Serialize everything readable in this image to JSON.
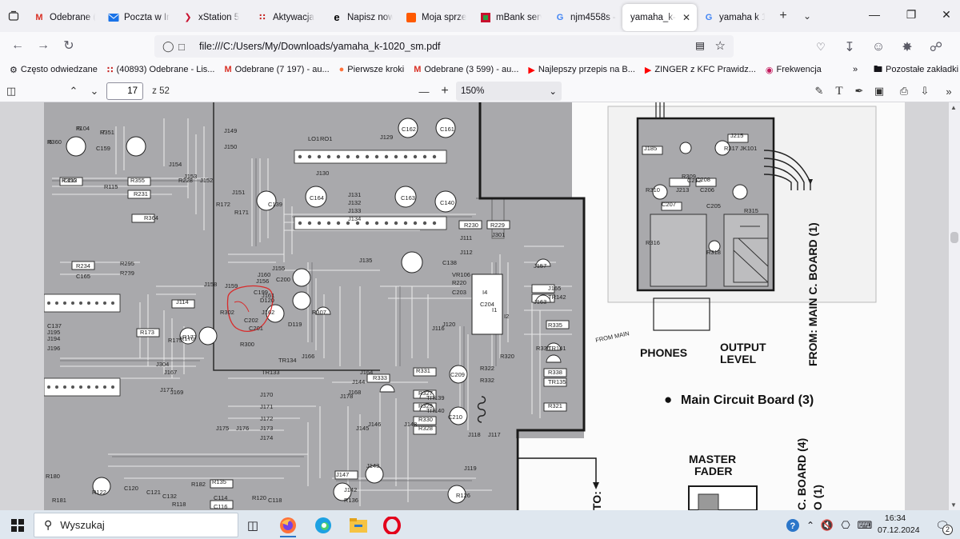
{
  "tabs": [
    {
      "title": "Odebrane (",
      "icon": "gmail-icon"
    },
    {
      "title": "Poczta w In",
      "icon": "mail-icon"
    },
    {
      "title": "xStation 5",
      "icon": "xstation-icon"
    },
    {
      "title": "Aktywacja",
      "icon": "grid-icon"
    },
    {
      "title": "Napisz now",
      "icon": "edge-e-icon"
    },
    {
      "title": "Moja sprze",
      "icon": "allegro-icon"
    },
    {
      "title": "mBank serv",
      "icon": "mbank-icon"
    },
    {
      "title": "njm4558s -",
      "icon": "google-icon"
    },
    {
      "title": "yamaha_k-1(",
      "icon": "none",
      "active": true
    },
    {
      "title": "yamaha k 1",
      "icon": "google-icon"
    }
  ],
  "url": "file:///C:/Users/My/Downloads/yamaha_k-1020_sm.pdf",
  "bookmarks": [
    {
      "label": "Często odwiedzane",
      "icon": "gear-icon"
    },
    {
      "label": "(40893) Odebrane - Lis...",
      "icon": "grid-icon"
    },
    {
      "label": "Odebrane (7 197) - au...",
      "icon": "gmail-icon"
    },
    {
      "label": "Pierwsze kroki",
      "icon": "firefox-icon"
    },
    {
      "label": "Odebrane (3 599) - au...",
      "icon": "gmail-icon"
    },
    {
      "label": "Najlepszy przepis na B...",
      "icon": "youtube-icon"
    },
    {
      "label": "ZINGER z KFC Prawidz...",
      "icon": "youtube-icon"
    },
    {
      "label": "Frekwencja",
      "icon": "link-icon"
    }
  ],
  "bookmarks_other": "Pozostałe zakładki",
  "pdf": {
    "page_current": "17",
    "page_total": "z 52",
    "zoom": "150%"
  },
  "schematic": {
    "labels_main": [
      "PHONES",
      "OUTPUT",
      "LEVEL",
      "Main Circuit Board (3)",
      "MASTER",
      "FADER",
      "FROM: MAIN C. BOARD (1)",
      "C. BOARD (4)",
      "O (1)",
      "TO:",
      "FROM MAIN"
    ],
    "parts": [
      "R360",
      "F104",
      "R351",
      "R356",
      "C159",
      "R115",
      "R355",
      "R231",
      "R228",
      "J154",
      "J149",
      "J150",
      "R364",
      "J153",
      "J152",
      "R172",
      "J151",
      "R171",
      "J155",
      "J160",
      "J161",
      "J162",
      "C139",
      "J129",
      "LO1",
      "RO1",
      "C162",
      "C161",
      "C164",
      "C163",
      "C140",
      "J130",
      "J131",
      "J132",
      "J133",
      "J134",
      "J135",
      "R230",
      "R229",
      "J111",
      "J301",
      "J112",
      "C138",
      "R234",
      "C165",
      "R295",
      "R239",
      "J158",
      "J159",
      "J156",
      "D120",
      "C200",
      "C199",
      "C202",
      "C201",
      "D119",
      "R302",
      "R307",
      "R300",
      "TR133",
      "TR134",
      "J166",
      "J157",
      "J165",
      "J163",
      "TR142",
      "R335",
      "R336",
      "TR141",
      "R338",
      "TR135",
      "R321",
      "R320",
      "R322",
      "R332",
      "R333",
      "R331",
      "R327",
      "R329",
      "R330",
      "R328",
      "C209",
      "C210",
      "TR139",
      "TR140",
      "J164",
      "J148",
      "J118",
      "J119",
      "J117",
      "J120",
      "J116",
      "J114",
      "R173",
      "R175",
      "R176",
      "R177",
      "C137",
      "J195",
      "J194",
      "J196",
      "J304",
      "J167",
      "J169",
      "J170",
      "J171",
      "J172",
      "J173",
      "J174",
      "J175",
      "J176",
      "J177",
      "J178",
      "J168",
      "J144",
      "J145",
      "J146",
      "J147",
      "J143",
      "J142",
      "R136",
      "R135",
      "C114",
      "C116",
      "R120",
      "C118",
      "R126",
      "R122",
      "C120",
      "C121",
      "C132",
      "R118",
      "R182",
      "R181",
      "R180",
      "J185",
      "J215",
      "J213",
      "R310",
      "R309",
      "C212",
      "C206",
      "C208",
      "C207",
      "C205",
      "R316",
      "R315",
      "R318",
      "R317",
      "JK101",
      "VR106",
      "R220",
      "C203",
      "C204",
      "I1",
      "I2",
      "I4",
      "I5",
      "I6",
      "I7",
      "IC113"
    ]
  },
  "taskbar": {
    "search_placeholder": "Wyszukaj",
    "time": "16:34",
    "date": "07.12.2024",
    "notif_count": "2"
  },
  "colors": {
    "accent": "#0061e0",
    "annotation": "#d92b2b",
    "taskbar_bg": "#dfe7ef"
  }
}
